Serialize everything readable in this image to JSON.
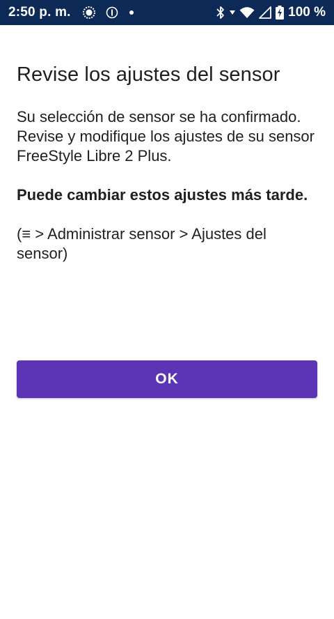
{
  "status_bar": {
    "time": "2:50 p. m.",
    "battery": "100 %",
    "icons": [
      "activity-ring-icon",
      "info-circle-icon",
      "notification-dot-icon",
      "bluetooth-icon",
      "wifi-icon",
      "cellular-signal-icon",
      "battery-charging-icon"
    ],
    "background": "#0d2a57"
  },
  "screen": {
    "title": "Revise los ajustes del sensor",
    "body": "Su selección de sensor se ha confirmado. Revise y modifique los ajustes de su sensor FreeStyle Libre 2 Plus.",
    "note": "Puede cambiar estos ajustes más tarde.",
    "path": "(≡ > Administrar sensor > Ajustes del sensor)"
  },
  "actions": {
    "ok_label": "OK",
    "accent": "#5b35b5"
  }
}
